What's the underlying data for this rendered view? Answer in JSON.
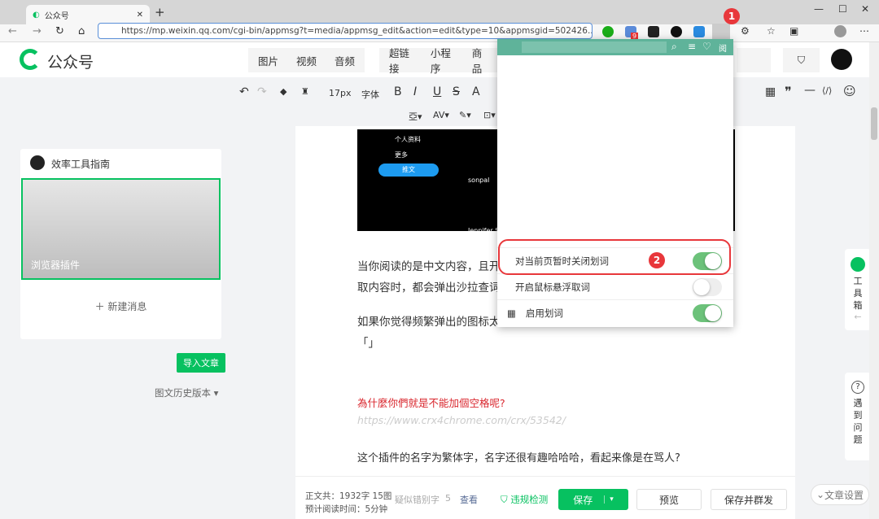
{
  "browser": {
    "tab_title": "公众号",
    "url": "https://mp.weixin.qq.com/cgi-bin/appmsg?t=media/appmsg_edit&action=edit&type=10&appmsgid=502426...",
    "ext_badge": "9"
  },
  "header": {
    "logo": "公众号",
    "media": [
      "图片",
      "视频",
      "音频"
    ],
    "insert": [
      "超链接",
      "小程序",
      "商品"
    ]
  },
  "toolbar": {
    "font_size": "17px",
    "font": "字体",
    "bold": "B",
    "italic": "I",
    "underline": "U",
    "strike": "S",
    "color": "A"
  },
  "left": {
    "account": "效率工具指南",
    "cover_title": "浏览器插件",
    "new_msg": "新建消息",
    "import": "导入文章",
    "history": "图文历史版本"
  },
  "article": {
    "p1": "当你阅读的是中文内容，且开",
    "p1b": "取内容时，都会弹出沙拉查词",
    "p2": "如果你觉得频繁弹出的图标太",
    "p2b": "「」",
    "red": "為什麼你們就是不能加個空格呢?",
    "link": "https://www.crx4chrome.com/crx/53542/",
    "p3": "这个插件的名字为繁体字，名字还很有趣哈哈哈，看起来像是在骂人?"
  },
  "screenshot": {
    "profile": "个人资料",
    "more": "更多",
    "post": "推文",
    "user": "sonpal",
    "user2": "Jennifer Serti"
  },
  "popup": {
    "rows": [
      {
        "label": "对当前页暂时关闭划词",
        "on": true
      },
      {
        "label": "开启鼠标悬浮取词",
        "on": false
      },
      {
        "label": "启用划词",
        "on": true
      }
    ],
    "badge1": "1",
    "badge2": "2",
    "header_icon": "阅"
  },
  "bottom": {
    "word_count": "正文共：1932字 15图",
    "read_time": "预计阅读时间：5分钟",
    "typo_label": "疑似错别字",
    "typo_count": "5",
    "view": "查看",
    "check": "违规检测",
    "save": "保存",
    "preview": "预览",
    "publish": "保存并群发",
    "settings": "文章设置"
  },
  "side": {
    "toolbox": "工具箱",
    "help": "遇到问题"
  }
}
